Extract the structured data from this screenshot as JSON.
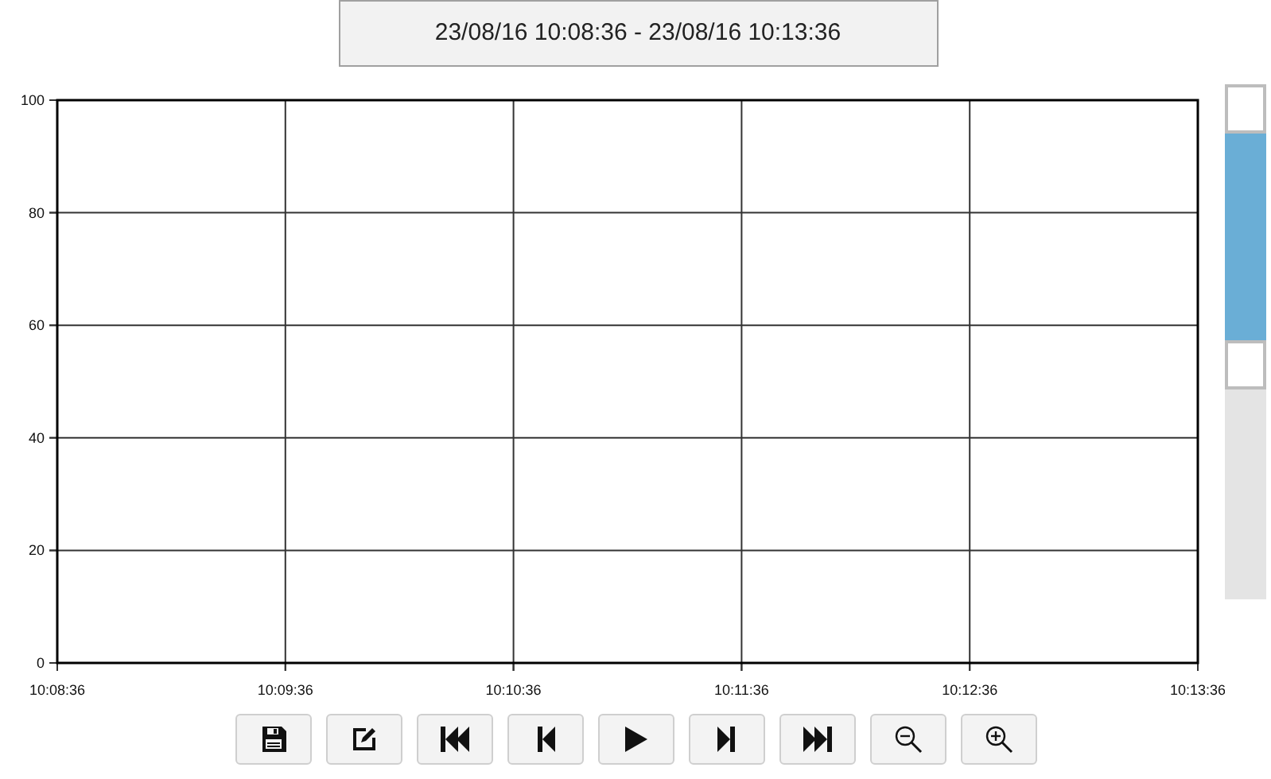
{
  "time_range": {
    "label": "23/08/16 10:08:36 - 23/08/16 10:13:36"
  },
  "chart": {
    "chart_data": {
      "type": "line",
      "grid": true,
      "ylim": [
        0,
        100
      ],
      "yticks": [
        0,
        20,
        40,
        60,
        80,
        100
      ],
      "categories": [
        "10:08:36",
        "10:09:36",
        "10:10:36",
        "10:11:36",
        "10:12:36",
        "10:13:36"
      ]
    }
  },
  "range_slider": {
    "thumbs": [
      {
        "level": 1
      },
      {
        "level": 0.45
      }
    ]
  },
  "toolbar": [
    {
      "kind": "save"
    },
    {
      "kind": "edit"
    },
    {
      "kind": "first"
    },
    {
      "kind": "previous"
    },
    {
      "kind": "play"
    },
    {
      "kind": "next"
    },
    {
      "kind": "last"
    },
    {
      "kind": "zoom_out"
    },
    {
      "kind": "zoom_in"
    }
  ]
}
